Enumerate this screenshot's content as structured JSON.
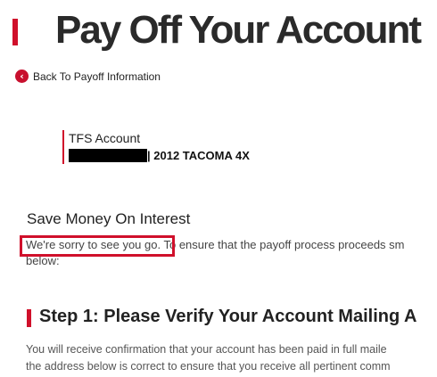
{
  "header": {
    "title": "Pay Off Your Account"
  },
  "nav": {
    "back_label": "Back To Payoff Information",
    "back_icon": "chevron-left-icon"
  },
  "account": {
    "label": "TFS Account",
    "vehicle": "| 2012 TACOMA 4X"
  },
  "interest": {
    "heading": "Save Money On Interest",
    "highlight_text": "We're sorry to see you go.",
    "line1_rest": " To ensure that the payoff process proceeds sm",
    "line2": "below:"
  },
  "step1": {
    "heading": "Step 1: Please Verify Your Account Mailing A",
    "body_line1": "You will receive confirmation that your account has been paid in full maile",
    "body_line2": "the address below is correct to ensure that you receive all pertinent comm"
  },
  "colors": {
    "accent": "#d0102b",
    "text": "#222222"
  }
}
